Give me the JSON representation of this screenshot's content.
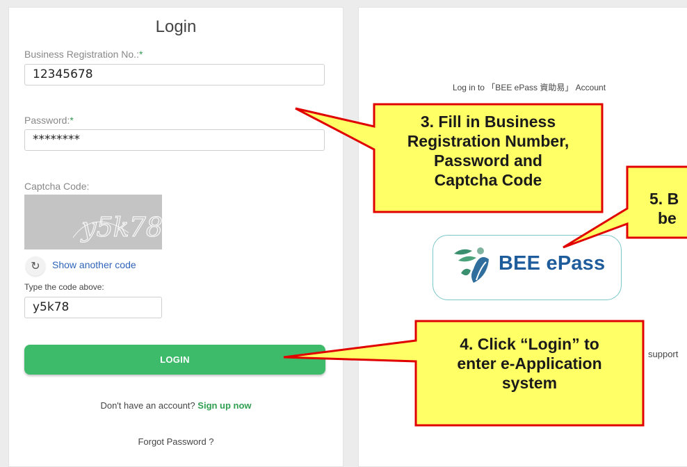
{
  "login": {
    "title": "Login",
    "brn_label": "Business Registration No.:",
    "brn_value": "12345678",
    "password_label": "Password:",
    "password_value": "********",
    "required_mark": "*",
    "captcha_label": "Captcha Code:",
    "captcha_image_text": "y5k78",
    "refresh_label": "Show another code",
    "type_code_label": "Type the code above:",
    "captcha_value": "y5k78",
    "login_button": "LOGIN",
    "no_account_text": "Don't have an account?",
    "signup_link": "Sign up now",
    "forgot_link": "Forgot Password ?"
  },
  "epass": {
    "login_text": "Log in to 「BEE ePass 資助易」 Account",
    "logo_text": "BEE ePass",
    "support_text": "support"
  },
  "callouts": {
    "step3": [
      "3. Fill in Business",
      "Registration Number,",
      "Password and",
      "Captcha Code"
    ],
    "step4": [
      "4. Click “Login” to",
      "enter e-Application",
      "system"
    ],
    "step5": [
      "5. B",
      "be"
    ]
  },
  "colors": {
    "login_button": "#3dbb6b",
    "link_green": "#2e9e51",
    "link_blue": "#2f64b8",
    "callout_fill": "#ffff66",
    "callout_border": "#e00000"
  }
}
